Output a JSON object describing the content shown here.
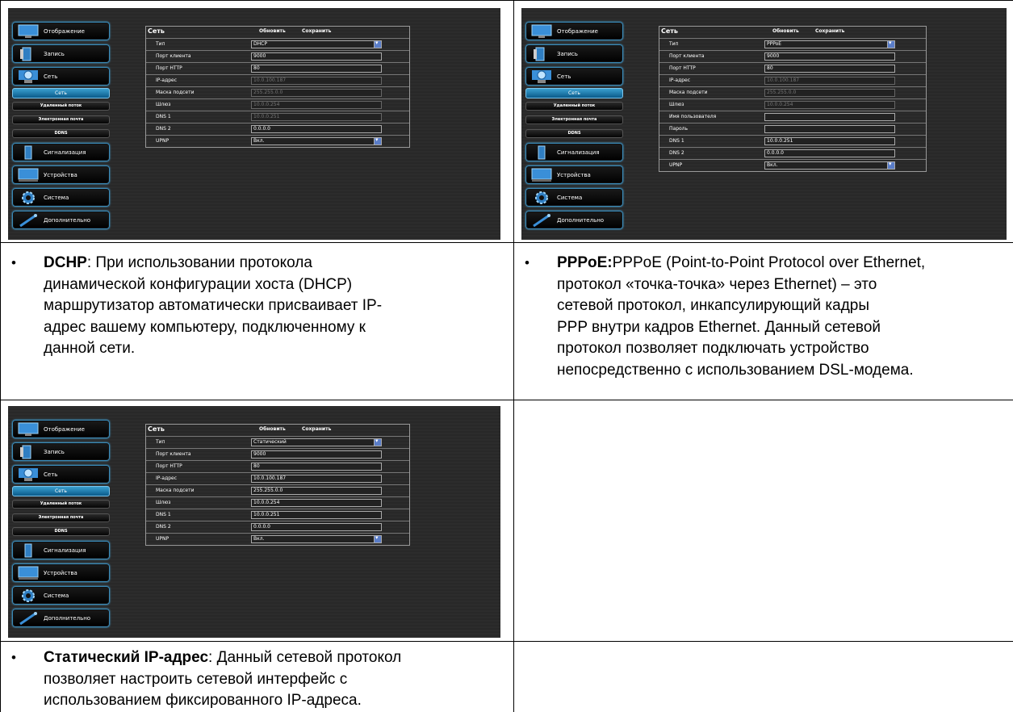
{
  "screens": [
    {
      "sidebar": {
        "main": [
          "Отображение",
          "Запись",
          "Сеть",
          "Сигнализация",
          "Устройства",
          "Система",
          "Дополнительно"
        ],
        "sub_active": "Сеть",
        "sub": [
          "Удаленный поток",
          "Электронная почта",
          "DDNS"
        ]
      },
      "panel": {
        "title": "Сеть",
        "refresh": "Обновить",
        "save": "Сохранить",
        "rows": [
          {
            "label": "Тип",
            "value": "DHCP",
            "kind": "select"
          },
          {
            "label": "Порт клиента",
            "value": "9000",
            "kind": "text"
          },
          {
            "label": "Порт HTTP",
            "value": "80",
            "kind": "text"
          },
          {
            "label": "IP-адрес",
            "value": "10.0.100.187",
            "kind": "disabled"
          },
          {
            "label": "Маска подсети",
            "value": "255.255.0.0",
            "kind": "disabled"
          },
          {
            "label": "Шлюз",
            "value": "10.0.0.254",
            "kind": "disabled"
          },
          {
            "label": "DNS 1",
            "value": "10.0.0.251",
            "kind": "disabled"
          },
          {
            "label": "DNS 2",
            "value": "0.0.0.0",
            "kind": "text"
          },
          {
            "label": "UPNP",
            "value": "Вкл.",
            "kind": "select"
          }
        ]
      }
    },
    {
      "sidebar": {
        "main": [
          "Отображение",
          "Запись",
          "Сеть",
          "Сигнализация",
          "Устройства",
          "Система",
          "Дополнительно"
        ],
        "sub_active": "Сеть",
        "sub": [
          "Удаленный поток",
          "Электронная почта",
          "DDNS"
        ]
      },
      "panel": {
        "title": "Сеть",
        "refresh": "Обновить",
        "save": "Сохранить",
        "rows": [
          {
            "label": "Тип",
            "value": "PPPoE",
            "kind": "select"
          },
          {
            "label": "Порт клиента",
            "value": "9000",
            "kind": "text"
          },
          {
            "label": "Порт HTTP",
            "value": "80",
            "kind": "text"
          },
          {
            "label": "IP-адрес",
            "value": "10.0.100.187",
            "kind": "disabled"
          },
          {
            "label": "Маска подсети",
            "value": "255.255.0.0",
            "kind": "disabled"
          },
          {
            "label": "Шлюз",
            "value": "10.0.0.254",
            "kind": "disabled"
          },
          {
            "label": "Имя пользователя",
            "value": "",
            "kind": "text"
          },
          {
            "label": "Пароль",
            "value": "",
            "kind": "text"
          },
          {
            "label": "DNS 1",
            "value": "10.0.0.251",
            "kind": "text"
          },
          {
            "label": "DNS 2",
            "value": "0.0.0.0",
            "kind": "text"
          },
          {
            "label": "UPNP",
            "value": "Вкл.",
            "kind": "select"
          }
        ]
      }
    },
    {
      "sidebar": {
        "main": [
          "Отображение",
          "Запись",
          "Сеть",
          "Сигнализация",
          "Устройства",
          "Система",
          "Дополнительно"
        ],
        "sub_active": "Сеть",
        "sub": [
          "Удаленный поток",
          "Электронная почта",
          "DDNS"
        ]
      },
      "panel": {
        "title": "Сеть",
        "refresh": "Обновить",
        "save": "Сохранить",
        "rows": [
          {
            "label": "Тип",
            "value": "Статический",
            "kind": "select"
          },
          {
            "label": "Порт клиента",
            "value": "9000",
            "kind": "text"
          },
          {
            "label": "Порт HTTP",
            "value": "80",
            "kind": "text"
          },
          {
            "label": "IP-адрес",
            "value": "10.0.100.187",
            "kind": "text"
          },
          {
            "label": "Маска подсети",
            "value": "255.255.0.0",
            "kind": "text"
          },
          {
            "label": "Шлюз",
            "value": "10.0.0.254",
            "kind": "text"
          },
          {
            "label": "DNS 1",
            "value": "10.0.0.251",
            "kind": "text"
          },
          {
            "label": "DNS 2",
            "value": "0.0.0.0",
            "kind": "text"
          },
          {
            "label": "UPNP",
            "value": "Вкл.",
            "kind": "select"
          }
        ]
      }
    }
  ],
  "descriptions": [
    {
      "bullet": "•",
      "term": "DCHP",
      "separator": ": ",
      "lines": [
        "При использовании протокола",
        "динамической конфигурации хоста (DHCP)",
        "маршрутизатор автоматически присваивает IP-",
        "адрес вашему компьютеру, подключенному к",
        "данной сети."
      ]
    },
    {
      "bullet": "•",
      "term": "PPPoE:",
      "separator": "",
      "lines": [
        "PPPoE (Point-to-Point Protocol over Ethernet,",
        "протокол «точка-точка» через Ethernet) – это",
        "сетевой протокол, инкапсулирующий кадры",
        "PPP внутри кадров Ethernet. Данный сетевой",
        "протокол позволяет подключать устройство",
        "непосредственно с использованием DSL-модема."
      ]
    },
    {
      "bullet": "•",
      "term": "Статический IP-адрес",
      "separator": ": ",
      "lines": [
        "Данный сетевой протокол",
        "позволяет настроить сетевой интерфейс с",
        "использованием фиксированного IP-адреса."
      ]
    }
  ]
}
